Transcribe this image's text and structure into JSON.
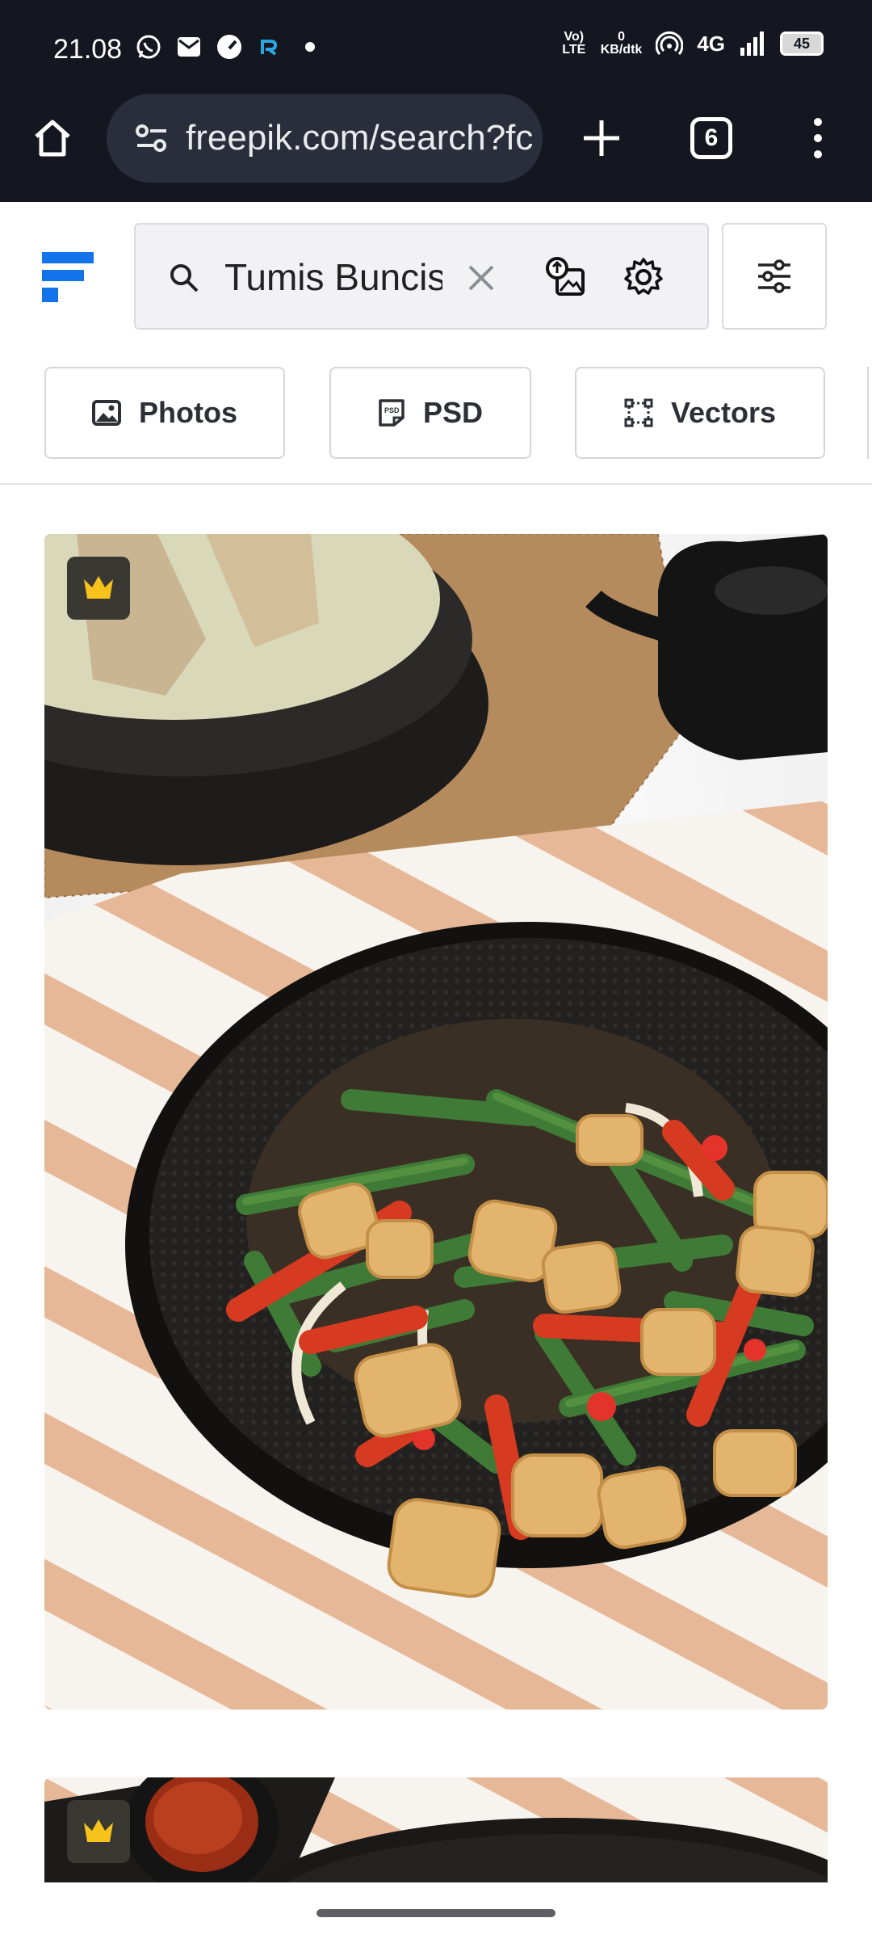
{
  "status_bar": {
    "time": "21.08",
    "volte_label": "Vo) LTE",
    "network_speed_value": "0",
    "network_speed_unit": "KB/dtk",
    "network_type": "4G",
    "battery": "45"
  },
  "browser": {
    "url": "freepik.com/search?fc",
    "tab_count": "6"
  },
  "search": {
    "query": "Tumis Buncis"
  },
  "filters": {
    "chips": [
      {
        "label": "Photos"
      },
      {
        "label": "PSD"
      },
      {
        "label": "Vectors"
      }
    ]
  },
  "results": [
    {
      "premium": true,
      "subject": "stir-fried green beans with tofu and red chili on black plate"
    },
    {
      "premium": true,
      "subject": "sambal in small black bowl on striped cloth"
    }
  ],
  "colors": {
    "chrome_bg": "#141720",
    "brand_blue": "#1273eb",
    "premium_gold": "#f7c21b"
  }
}
